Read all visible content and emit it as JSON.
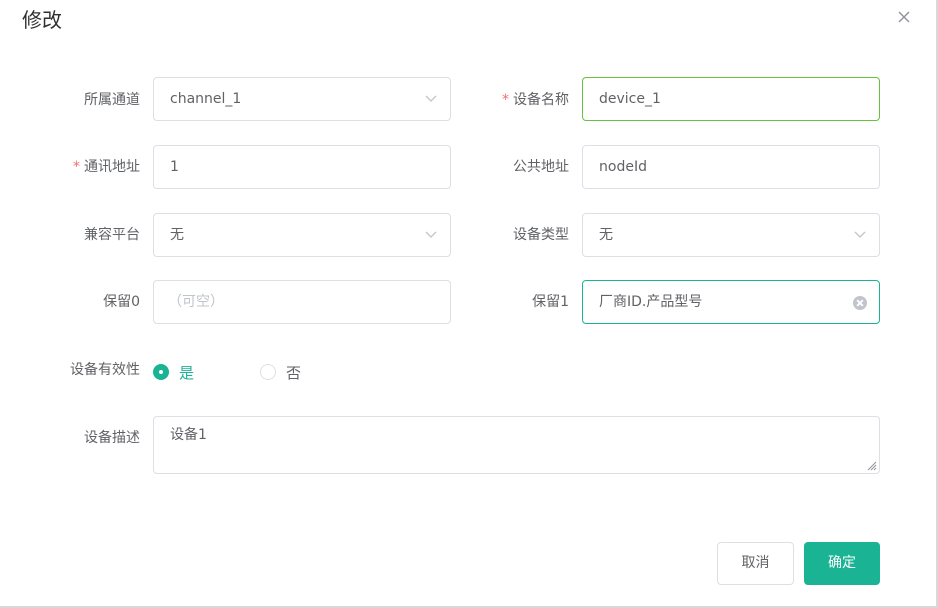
{
  "dialog": {
    "title": "修改"
  },
  "form": {
    "channel": {
      "label": "所属通道",
      "value": "channel_1"
    },
    "device_name": {
      "label": "设备名称",
      "value": "device_1",
      "required": "*"
    },
    "address": {
      "label": "通讯地址",
      "value": "1",
      "required": "*"
    },
    "common_address": {
      "label": "公共地址",
      "value": "nodeId"
    },
    "platform": {
      "label": "兼容平台",
      "value": "无"
    },
    "device_type": {
      "label": "设备类型",
      "value": "无"
    },
    "reserve0": {
      "label": "保留0",
      "placeholder": "（可空）"
    },
    "reserve1": {
      "label": "保留1",
      "value": "厂商ID.产品型号"
    },
    "validity": {
      "label": "设备有效性",
      "options": [
        "是",
        "否"
      ],
      "selected": "是"
    },
    "description": {
      "label": "设备描述",
      "value": "设备1"
    }
  },
  "footer": {
    "cancel_label": "取消",
    "confirm_label": "确定"
  },
  "colors": {
    "accent": "#1ab394",
    "focus_green": "#67c23a",
    "required": "#f56c6c"
  }
}
